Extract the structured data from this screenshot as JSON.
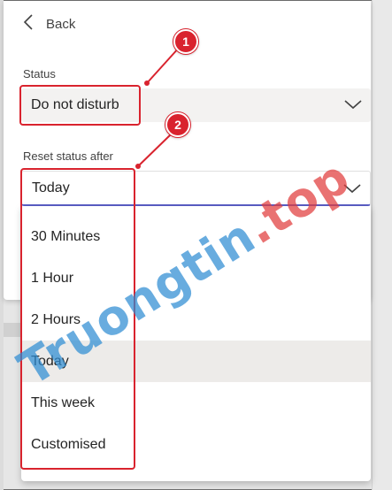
{
  "back": {
    "label": "Back"
  },
  "status": {
    "label": "Status",
    "value": "Do not disturb"
  },
  "reset": {
    "label": "Reset status after",
    "value": "Today",
    "options": [
      {
        "label": "30 Minutes",
        "selected": false
      },
      {
        "label": "1 Hour",
        "selected": false
      },
      {
        "label": "2 Hours",
        "selected": false
      },
      {
        "label": "Today",
        "selected": true
      },
      {
        "label": "This week",
        "selected": false
      },
      {
        "label": "Customised",
        "selected": false
      }
    ]
  },
  "annotations": {
    "badge1": "1",
    "badge2": "2"
  },
  "watermark": {
    "text": "Truongtin",
    "tld": ".top"
  },
  "colors": {
    "annotation_red": "#d9232e",
    "focus_underline": "#5b5fc7",
    "selected_row": "#edebe9",
    "field_background": "#f3f2f1"
  },
  "icons": {
    "back": "chevron-left-icon",
    "dropdown": "chevron-down-icon"
  }
}
